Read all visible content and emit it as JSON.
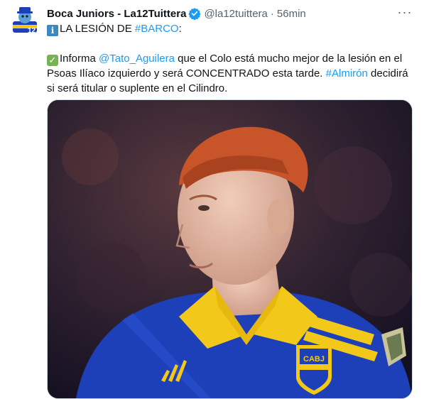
{
  "tweet": {
    "author_name": "Boca Juniors - La12Tuittera",
    "handle": "@la12tuittera",
    "separator": "·",
    "time": "56min",
    "more_label": "···",
    "avatar_badge": "12",
    "line1": {
      "info_emoji": "i",
      "prefix": "LA LESIÓN DE ",
      "hashtag": "#BARCO",
      "suffix": ":"
    },
    "line2": {
      "check_emoji": "✓",
      "part1": "Informa ",
      "mention": "@Tato_Aguilera",
      "part2": " que el Colo está mucho mejor de la lesión en el Psoas Ilíaco izquierdo y será CONCENTRADO esta tarde. ",
      "hashtag": "#Almirón",
      "part3": " decidirá si será titular o suplente en el Cilindro."
    }
  },
  "media": {
    "crest_text": "CABJ",
    "colors": {
      "jersey_blue": "#1d3fb8",
      "jersey_yellow": "#f2c81a",
      "hair": "#c8552a"
    }
  },
  "colors": {
    "link": "#1d9bf0",
    "verified": "#1d9bf0",
    "secondary": "#536471"
  }
}
